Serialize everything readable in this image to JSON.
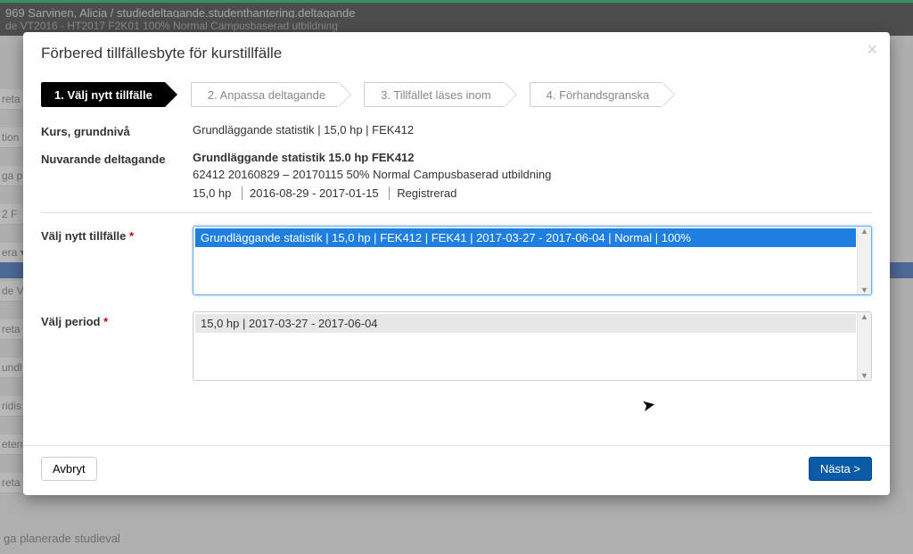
{
  "background": {
    "header": "969 Sarvinen, Alicia / studiedeltagande.studenthantering.deltagande",
    "sub": "de VT2016 - HT2017 F2K01 100% Normal Campusbaserad utbildning",
    "side": [
      "reta",
      "tion",
      "ga p",
      "2 F",
      "era ▾",
      "de V",
      "reta",
      "undl",
      "ridis",
      "etern",
      "reta"
    ],
    "footer": "ga planerade studieval"
  },
  "modal": {
    "title": "Förbered tillfällesbyte för kurstillfälle",
    "close": "×",
    "steps": [
      "1. Välj nytt tillfälle",
      "2. Anpassa deltagande",
      "3. Tillfället läses inom",
      "4. Förhandsgranska"
    ],
    "course_label": "Kurs, grundnivå",
    "course_value": "Grundläggande statistik | 15,0 hp | FEK412",
    "current_label": "Nuvarande deltagande",
    "current_title": "Grundläggande statistik 15.0 hp FEK412",
    "current_detail": "62412 20160829 – 20170115 50% Normal Campusbaserad utbildning",
    "current_meta_hp": "15,0 hp",
    "current_meta_dates": "2016-08-29 - 2017-01-15",
    "current_meta_status": "Registrerad",
    "select_new_label": "Välj nytt tillfälle",
    "select_new_option": "Grundläggande statistik | 15,0 hp | FEK412 | FEK41 | 2017-03-27 - 2017-06-04 | Normal | 100%",
    "select_period_label": "Välj period",
    "select_period_option": "15,0 hp | 2017-03-27 - 2017-06-04",
    "required": "*",
    "cancel": "Avbryt",
    "next": "Nästa >"
  }
}
